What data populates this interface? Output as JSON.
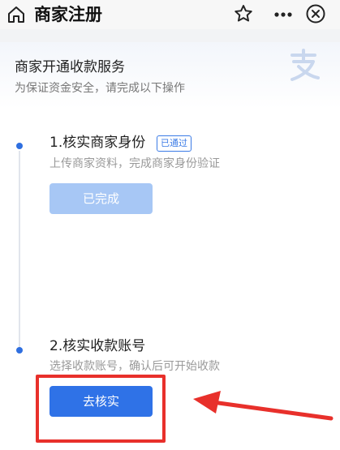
{
  "nav": {
    "title": "商家注册",
    "icons": [
      "home-icon",
      "star-icon",
      "more-icon",
      "close-icon"
    ]
  },
  "header": {
    "title": "商家开通收款服务",
    "subtitle": "为保证资金安全，请完成以下操作",
    "logo_icon": "alipay-logo"
  },
  "steps": [
    {
      "title": "1.核实商家身份",
      "badge": "已通过",
      "description": "上传商家资料，完成商家身份验证",
      "button_label": "已完成",
      "completed": true
    },
    {
      "title": "2.核实收款账号",
      "description": "选择收款账号，确认后可开始收款",
      "button_label": "去核实",
      "completed": false
    }
  ],
  "colors": {
    "accent": "#2f72e7",
    "accent_disabled": "#a7c7f5",
    "highlight": "#e8302b"
  }
}
